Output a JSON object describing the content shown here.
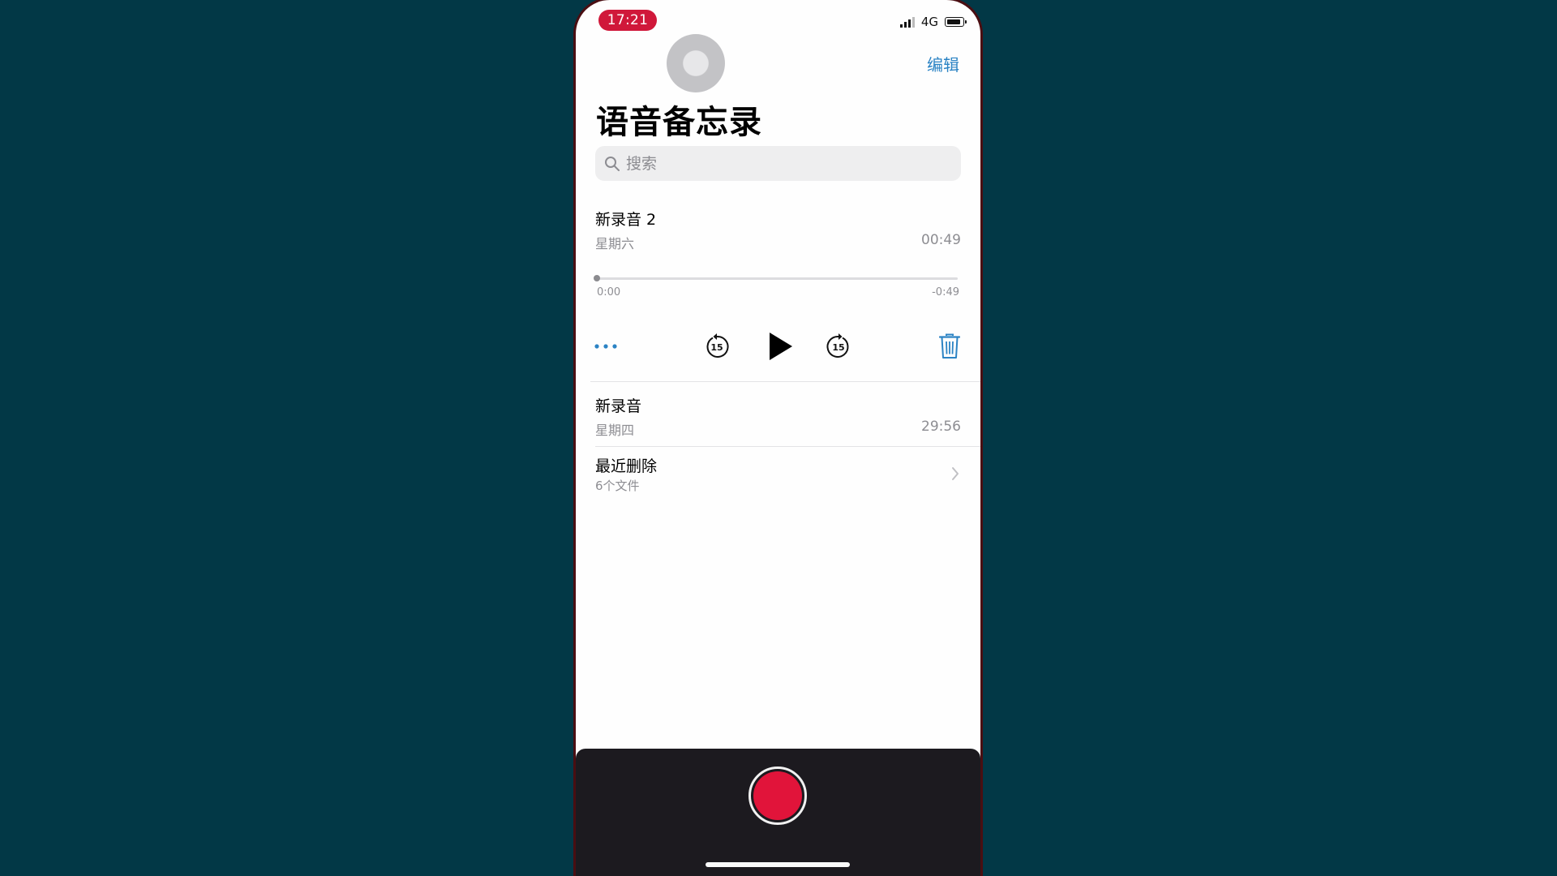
{
  "status": {
    "time": "17:21",
    "network": "4G"
  },
  "header": {
    "edit_label": "编辑",
    "title": "语音备忘录"
  },
  "search": {
    "placeholder": "搜索",
    "value": ""
  },
  "recordings": [
    {
      "name": "新录音 2",
      "date": "星期六",
      "duration": "00:49",
      "expanded": true,
      "elapsed": "0:00",
      "remaining": "-0:49",
      "progress": 0
    },
    {
      "name": "新录音",
      "date": "星期四",
      "duration": "29:56",
      "expanded": false
    }
  ],
  "recently_deleted": {
    "label": "最近删除",
    "count_label": "6个文件"
  },
  "player_controls": {
    "more": "more-icon",
    "skip_back": "skip-back-15-icon",
    "skip_back_seconds": "15",
    "play": "play-icon",
    "skip_forward": "skip-forward-15-icon",
    "skip_forward_seconds": "15",
    "delete": "trash-icon"
  },
  "colors": {
    "accent": "#2b83c4",
    "record": "#e1143a",
    "background": "#023846",
    "bottom_bar": "#1c1a1f",
    "time_pill": "#d0183a"
  }
}
